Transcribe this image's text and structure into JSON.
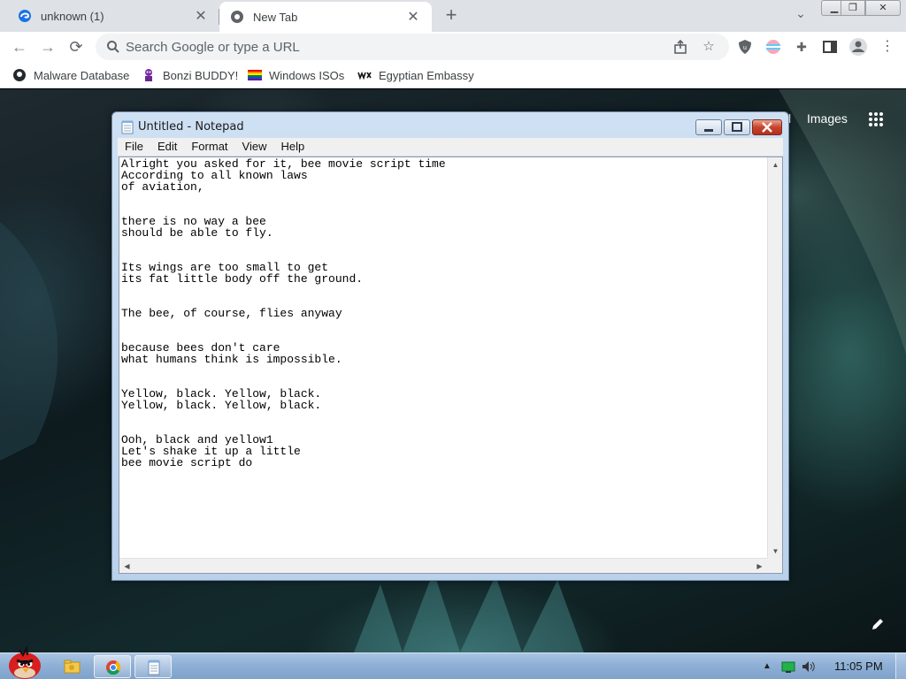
{
  "browser": {
    "tabs": [
      {
        "title": "unknown (1)",
        "close_glyph": "✕",
        "icon": "edge-swirl-icon"
      },
      {
        "title": "New Tab",
        "close_glyph": "✕",
        "icon": "chrome-icon"
      }
    ],
    "new_tab_glyph": "+",
    "tab_search_glyph": "⌄",
    "window_controls": {
      "minimize": "▁",
      "maximize": "❐",
      "close": "✕"
    },
    "nav": {
      "back": "←",
      "forward": "→",
      "reload": "⟳"
    },
    "omnibox": {
      "placeholder": "Search Google or type a URL",
      "value": ""
    },
    "toolbar_icons": [
      "share-icon",
      "bookmark-star-icon",
      "ublock-icon",
      "flag-extension-icon",
      "extensions-puzzle-icon",
      "side-panel-icon",
      "profile-icon",
      "chrome-menu-icon"
    ],
    "bookmarks": [
      {
        "label": "Malware Database",
        "icon": "github-icon"
      },
      {
        "label": "Bonzi BUDDY!",
        "icon": "bonzi-icon"
      },
      {
        "label": "Windows ISOs",
        "icon": "rainbow-flag-icon"
      },
      {
        "label": "Egyptian Embassy",
        "icon": "wix-icon"
      }
    ]
  },
  "new_tab_page": {
    "gmail_partial": "l",
    "images_link": "Images",
    "apps_icon": "google-apps-icon",
    "customize_icon": "pencil-icon"
  },
  "notepad": {
    "title": "Untitled - Notepad",
    "menu": [
      "File",
      "Edit",
      "Format",
      "View",
      "Help"
    ],
    "content": "Alright you asked for it, bee movie script time\nAccording to all known laws\nof aviation,\n\n\nthere is no way a bee\nshould be able to fly.\n\n\nIts wings are too small to get\nits fat little body off the ground.\n\n\nThe bee, of course, flies anyway\n\n\nbecause bees don't care\nwhat humans think is impossible.\n\n\nYellow, black. Yellow, black.\nYellow, black. Yellow, black.\n\n\nOoh, black and yellow1\nLet's shake it up a little\nbee movie script do"
  },
  "taskbar": {
    "pinned": [
      "windows-explorer-icon",
      "chrome-icon",
      "notepad-icon"
    ],
    "clock": "11:05 PM",
    "tray_up": "▲"
  },
  "colors": {
    "tabstrip": "#dee1e6",
    "taskbar": "#8fb0d6",
    "notepad_frame": "#b9d1ea",
    "close_red": "#c8432a"
  }
}
